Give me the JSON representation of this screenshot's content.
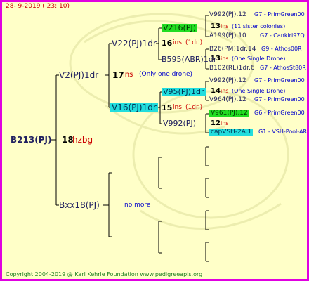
{
  "header": {
    "date": "28-  9-2019 ( 23: 10)"
  },
  "footer": {
    "copyright": "Copyright 2004-2019 @ Karl Kehrle Foundation   www.pedigreeapis.org"
  },
  "colors": {
    "frame": "#e000e0",
    "bg": "#ffffc8",
    "green_highlight": "#22dd22",
    "cyan_highlight": "#22dddd"
  },
  "root": {
    "name": "B213(PJ)",
    "gen": "18",
    "info": "hzbg"
  },
  "gen1": {
    "top": {
      "name": "V2(PJ)1dr",
      "gen": "17",
      "ins": "ins",
      "info": "(Only one drone)"
    },
    "bottom": {
      "name": "Bxx18(PJ)",
      "info": "no more"
    }
  },
  "gen2": {
    "a": {
      "name": "V22(PJ)1dr"
    },
    "b": {
      "name": "V16(PJ)1dr"
    }
  },
  "gen3": {
    "a1": {
      "name": "V216(PJ)",
      "gen": "16",
      "ins": "ins",
      "info": "(1dr.)"
    },
    "a2": {
      "name": "B595(ABR)1dr"
    },
    "b1": {
      "name": "V95(PJ)1dr",
      "gen": "15",
      "ins": "ins",
      "info": "(1dr.)"
    },
    "b2": {
      "name": "V992(PJ)"
    }
  },
  "gen4": {
    "r1": {
      "name": "V992(PJ).12",
      "ext": "G7 - PrimGreen00"
    },
    "r2": {
      "gen": "13",
      "ins": "ins",
      "info": "(11 sister colonies)"
    },
    "r3": {
      "name": "A199(PJ).10",
      "ext": "G7 - Cankiri97Q"
    },
    "r4": {
      "name": "B26(PM)1dr.14",
      "ext": "G9 - Athos00R"
    },
    "r5": {
      "gen": "13",
      "ins": "ins",
      "info": "(One Single Drone)"
    },
    "r6": {
      "name": "B102(RL)1dr.6",
      "ext": "G7 - AthosSt80R"
    },
    "r7": {
      "name": "V992(PJ).12",
      "ext": "G7 - PrimGreen00"
    },
    "r8": {
      "gen": "14",
      "ins": "ins",
      "info": "(One Single Drone)"
    },
    "r9": {
      "name": "V964(PJ).12",
      "ext": "G7 - PrimGreen00"
    },
    "r10": {
      "name": "V961(PJ).12",
      "ext": "G6 - PrimGreen00"
    },
    "r11": {
      "gen": "12",
      "ins": "ins"
    },
    "r12": {
      "name": "capVSH-2A.1",
      "ext": "G1 - VSH-Pool-AR"
    }
  }
}
